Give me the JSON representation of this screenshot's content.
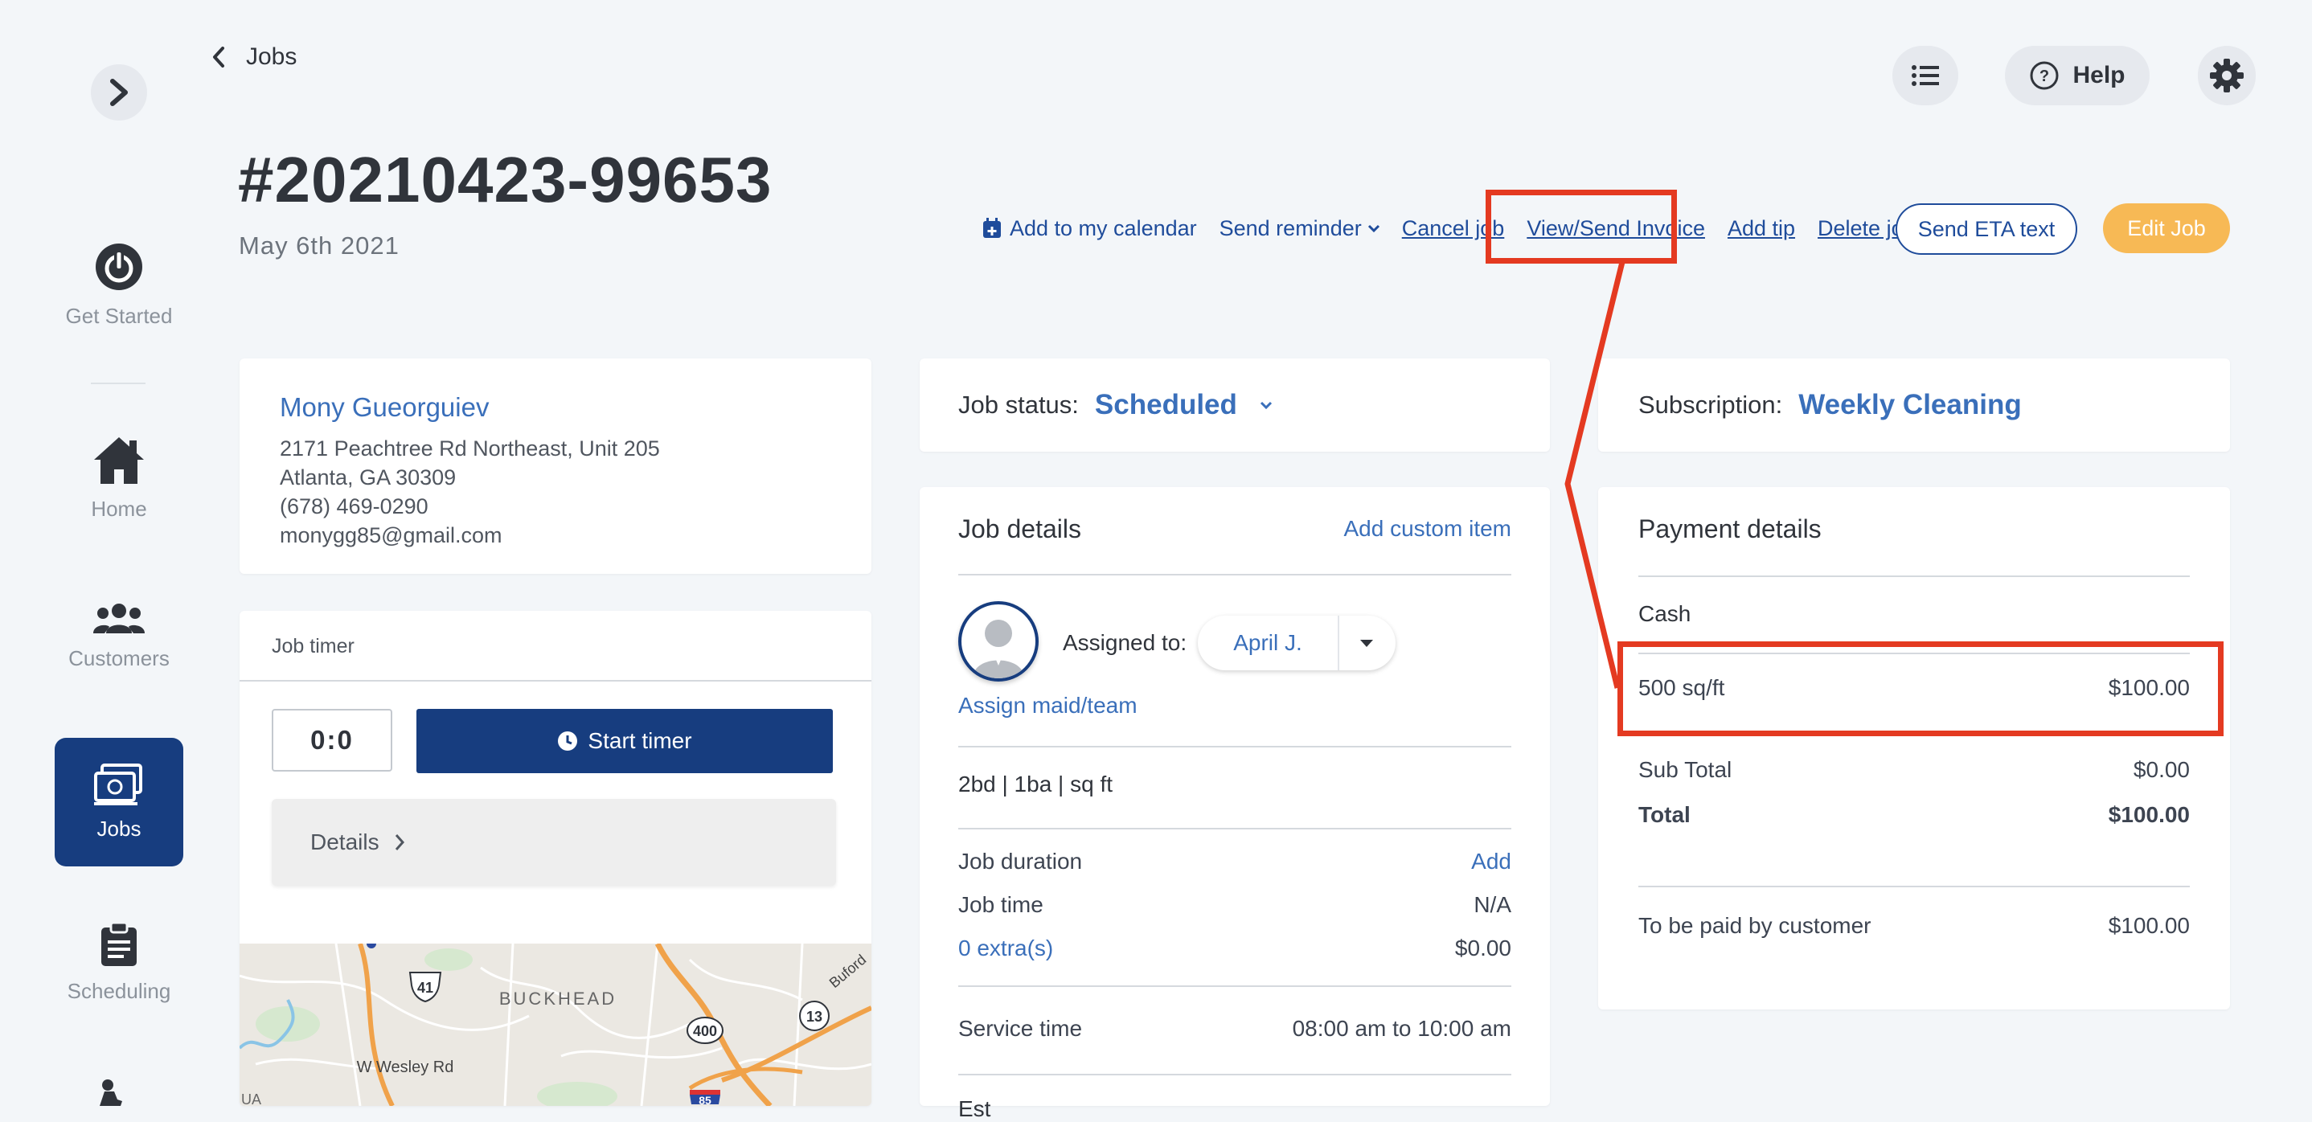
{
  "sidebar": {
    "items": [
      {
        "label": "Get Started"
      },
      {
        "label": "Home"
      },
      {
        "label": "Customers"
      },
      {
        "label": "Jobs"
      },
      {
        "label": "Scheduling"
      }
    ]
  },
  "header": {
    "back_label": "Jobs",
    "help_label": "Help"
  },
  "job": {
    "number": "#20210423-99653",
    "date": "May 6th 2021"
  },
  "actions": {
    "add_calendar": "Add to my calendar",
    "send_reminder": "Send reminder",
    "cancel_job": "Cancel job",
    "view_invoice": "View/Send Invoice",
    "add_tip": "Add tip",
    "delete_job": "Delete job",
    "send_eta": "Send ETA text",
    "edit_job": "Edit Job"
  },
  "customer": {
    "name": "Mony Gueorguiev",
    "address1": "2171 Peachtree Rd Northeast, Unit 205",
    "address2": "Atlanta, GA 30309",
    "phone": "(678) 469-0290",
    "email": "monygg85@gmail.com"
  },
  "timer": {
    "title": "Job timer",
    "value": "0:0",
    "start_label": "Start timer",
    "details_label": "Details"
  },
  "map": {
    "labels": {
      "buckhead": "BUCKHEAD",
      "wesley": "W Wesley Rd",
      "buford": "Buford",
      "shield41": "41",
      "shield400": "400",
      "shield13": "13",
      "shield85": "85",
      "partial": "UA"
    }
  },
  "status": {
    "label": "Job status:",
    "value": "Scheduled"
  },
  "subscription": {
    "label": "Subscription:",
    "value": "Weekly Cleaning"
  },
  "job_details": {
    "title": "Job details",
    "add_custom": "Add custom item",
    "assigned_label": "Assigned to:",
    "assignee": "April J.",
    "assign_link": "Assign maid/team",
    "specs": "2bd | 1ba | sq ft",
    "duration_label": "Job duration",
    "duration_action": "Add",
    "time_label": "Job time",
    "time_value": "N/A",
    "extras_label": "0 extra(s)",
    "extras_value": "$0.00",
    "service_label": "Service time",
    "service_value": "08:00 am to 10:00 am",
    "cut_label": "Est"
  },
  "payment": {
    "title": "Payment details",
    "method": "Cash",
    "item_label": "500 sq/ft",
    "item_value": "$100.00",
    "subtotal_label": "Sub Total",
    "subtotal_value": "$0.00",
    "total_label": "Total",
    "total_value": "$100.00",
    "to_pay_label": "To be paid by customer",
    "to_pay_value": "$100.00"
  },
  "colors": {
    "accent": "#1f4c9b",
    "nav_active": "#173d7f",
    "edit_button": "#f7b955",
    "highlight": "#e43a21"
  }
}
